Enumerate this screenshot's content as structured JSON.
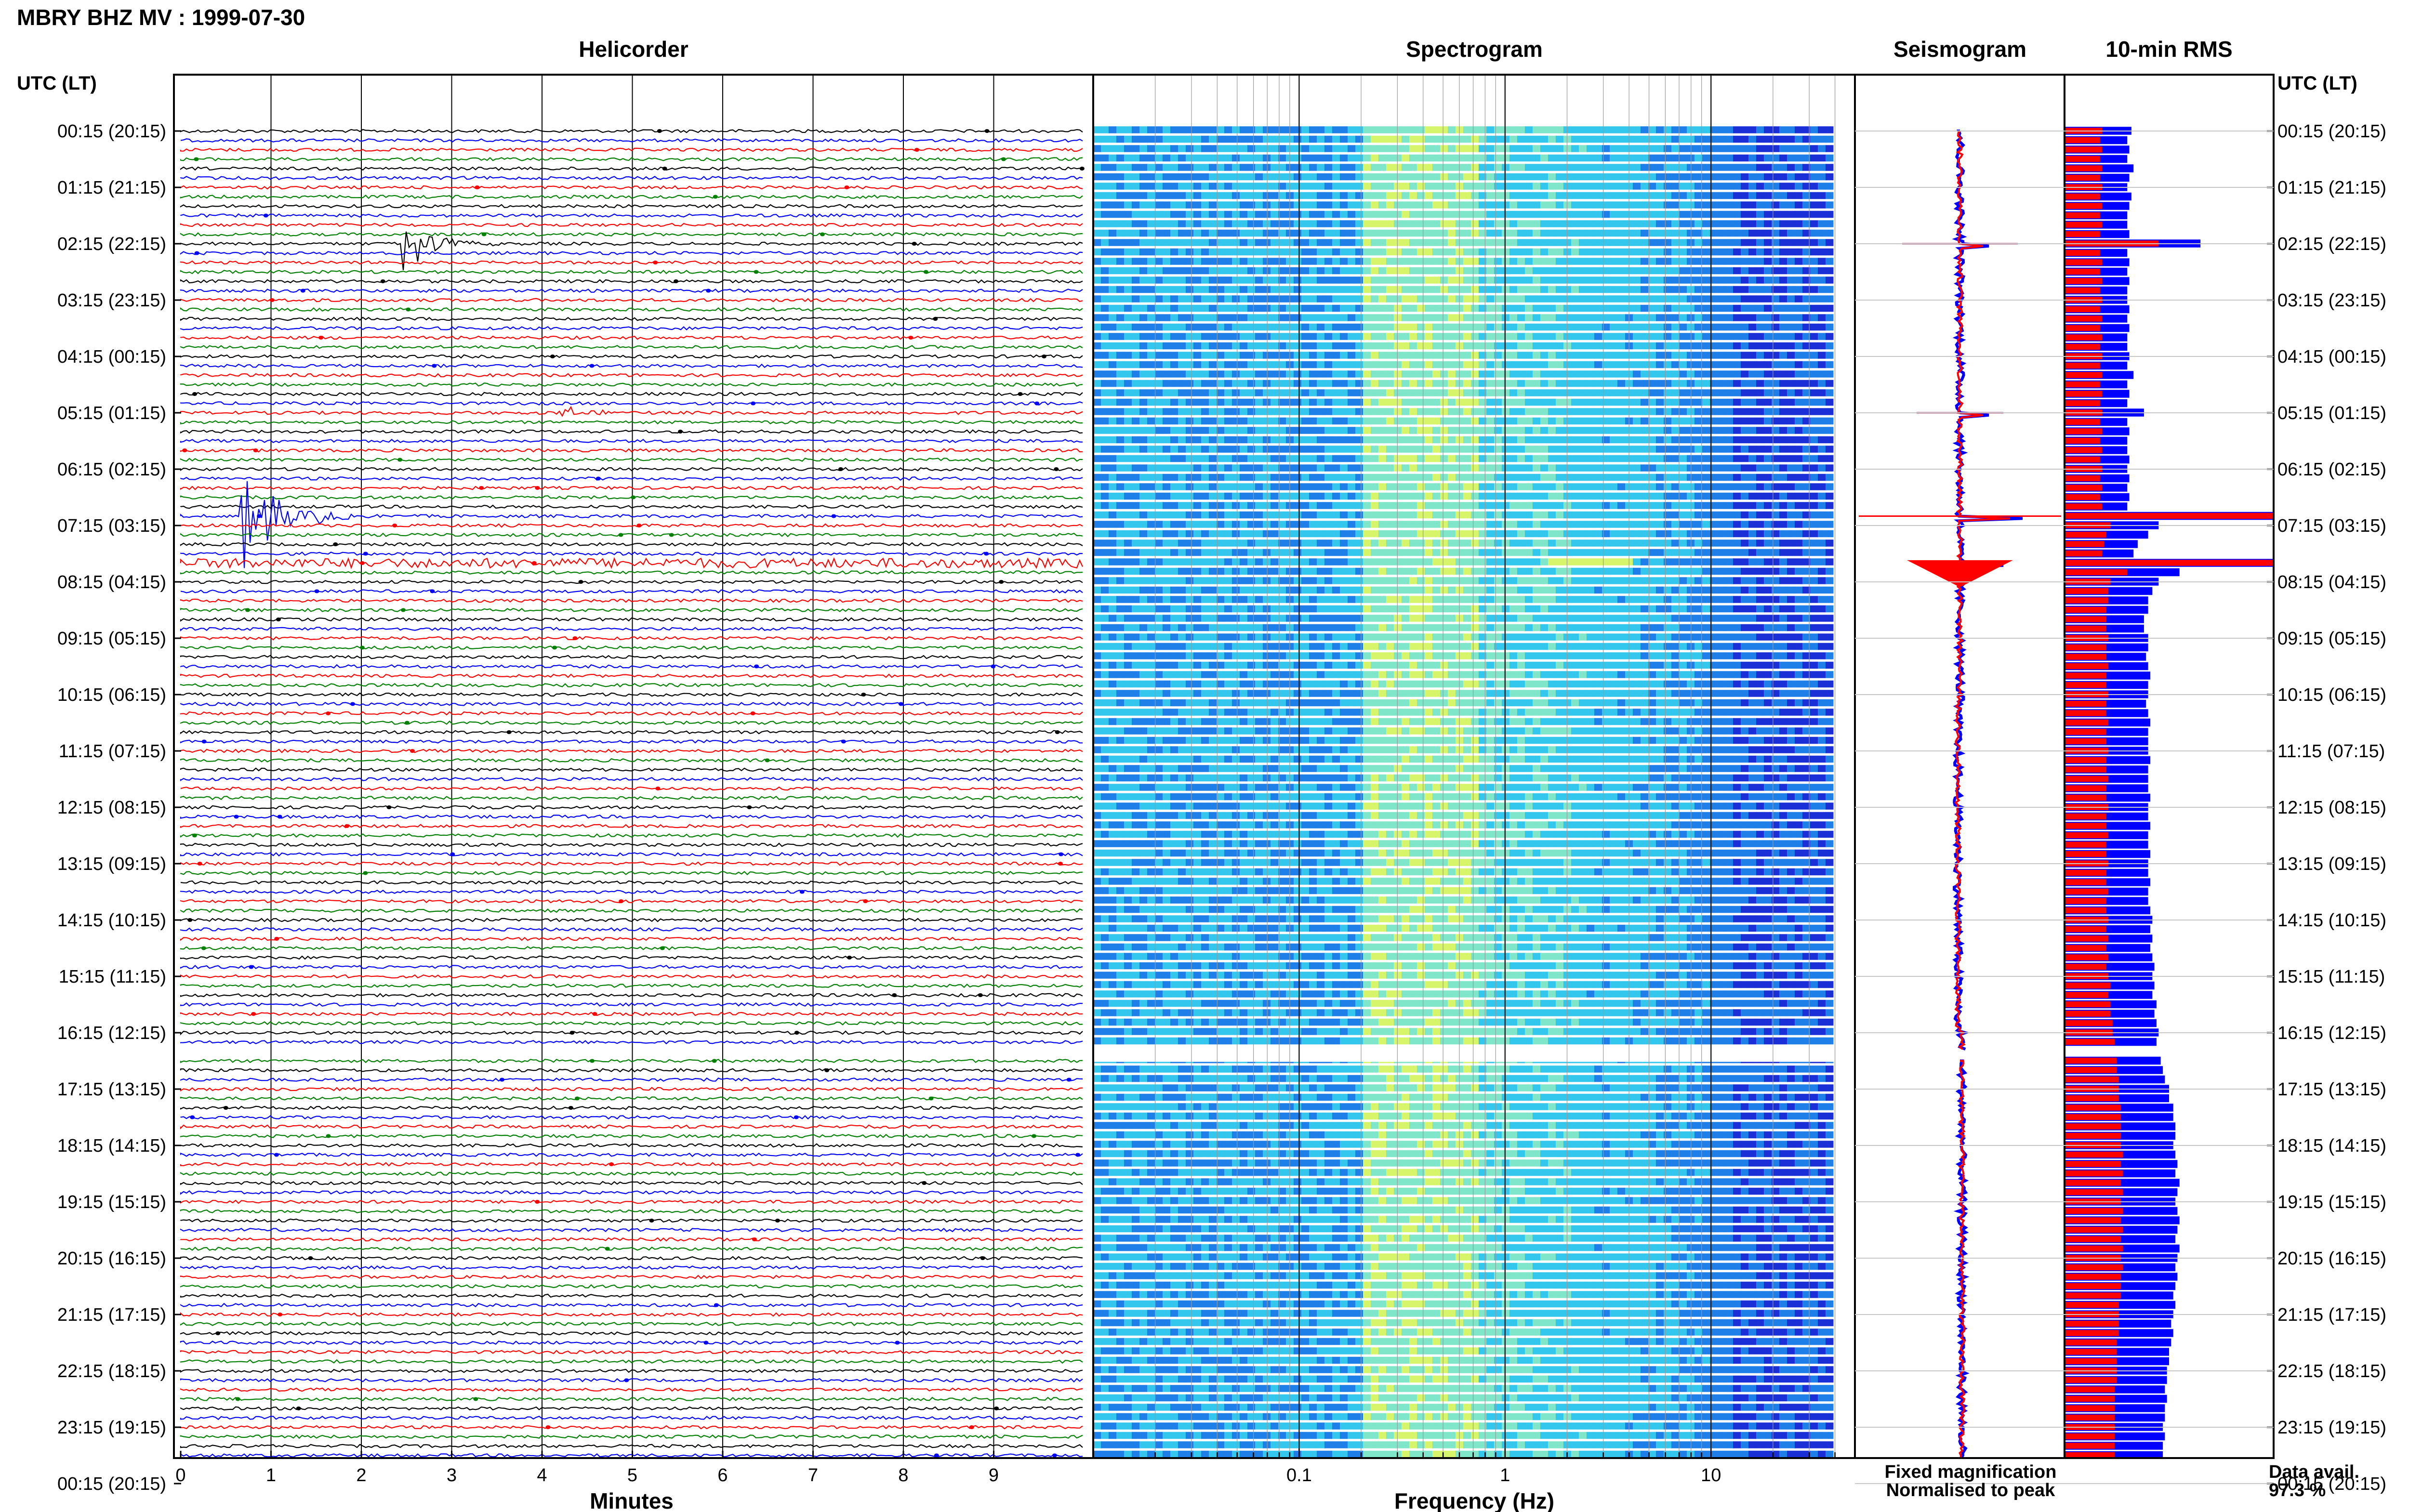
{
  "page_title": "MBRY BHZ MV : 1999-07-30",
  "panels": {
    "helicorder": "Helicorder",
    "spectrogram": "Spectrogram",
    "seismogram": "Seismogram",
    "rms": "10-min RMS"
  },
  "time_axis_label": "UTC (LT)",
  "time_labels": [
    "00:15 (20:15)",
    "01:15 (21:15)",
    "02:15 (22:15)",
    "03:15 (23:15)",
    "04:15 (00:15)",
    "05:15 (01:15)",
    "06:15 (02:15)",
    "07:15 (03:15)",
    "08:15 (04:15)",
    "09:15 (05:15)",
    "10:15 (06:15)",
    "11:15 (07:15)",
    "12:15 (08:15)",
    "13:15 (09:15)",
    "14:15 (10:15)",
    "15:15 (11:15)",
    "16:15 (12:15)",
    "17:15 (13:15)",
    "18:15 (14:15)",
    "19:15 (15:15)",
    "20:15 (16:15)",
    "21:15 (17:15)",
    "22:15 (18:15)",
    "23:15 (19:15)",
    "00:15 (20:15)"
  ],
  "legend": {
    "fixed": "Fixed magnification",
    "normalised": "Normalised to peak",
    "fixed_color": "#0000ff",
    "normalised_color": "#ff0000"
  },
  "data_availability": {
    "label": "Data avail.",
    "value": "97.3 %"
  },
  "chart_data": [
    {
      "type": "line",
      "title": "Helicorder",
      "xlabel": "Minutes",
      "ylabel": "UTC (LT)",
      "xlim": [
        0,
        10
      ],
      "x_ticks": [
        "0",
        "1",
        "2",
        "3",
        "4",
        "5",
        "6",
        "7",
        "8",
        "9"
      ],
      "trace_colors": [
        "#000000",
        "#0000ff",
        "#ff0000",
        "#008000"
      ],
      "rows": 144,
      "gap_rows": [
        98
      ],
      "events": [
        {
          "row": 12,
          "minute": 2.5,
          "amplitude": 1.4,
          "color": "#000000"
        },
        {
          "row": 30,
          "minute": 4.25,
          "amplitude": 0.35,
          "color": "#000000"
        },
        {
          "row": 41,
          "minute": 0.7,
          "amplitude": 3.2,
          "color": "#008000"
        },
        {
          "row": 41,
          "minute": 1.55,
          "amplitude": 0.3,
          "color": "#008000"
        },
        {
          "row": 46,
          "minute": 0.0,
          "amplitude": 0.6,
          "color": "#0000ff",
          "type": "tremor"
        }
      ]
    },
    {
      "type": "heatmap",
      "title": "Spectrogram",
      "xlabel": "Frequency (Hz)",
      "x_scale": "log",
      "xlim": [
        0.01,
        50
      ],
      "x_ticks": [
        "0.1",
        "1",
        "10"
      ],
      "colormap": [
        "#1a2fd6",
        "#1f7fe8",
        "#33c7ee",
        "#7fe6c9",
        "#d7f56b"
      ],
      "peak_band_hz": [
        0.2,
        0.6
      ],
      "gap_rows": [
        98
      ]
    },
    {
      "type": "line",
      "title": "Seismogram",
      "series": [
        {
          "name": "Fixed magnification",
          "color": "#0000ff"
        },
        {
          "name": "Normalised to peak",
          "color": "#ff0000"
        }
      ],
      "spikes_at_rows": [
        12,
        30,
        41,
        46
      ]
    },
    {
      "type": "bar",
      "title": "10-min RMS",
      "orientation": "horizontal",
      "series": [
        {
          "name": "Fixed magnification",
          "color": "#0000ff",
          "values": [
            0.32,
            0.3,
            0.31,
            0.3,
            0.33,
            0.31,
            0.3,
            0.32,
            0.31,
            0.3,
            0.3,
            0.31,
            0.65,
            0.3,
            0.31,
            0.3,
            0.31,
            0.3,
            0.3,
            0.31,
            0.3,
            0.31,
            0.3,
            0.3,
            0.31,
            0.3,
            0.33,
            0.3,
            0.31,
            0.3,
            0.38,
            0.3,
            0.31,
            0.3,
            0.3,
            0.31,
            0.3,
            0.31,
            0.3,
            0.31,
            0.3,
            1.0,
            0.45,
            0.4,
            0.35,
            0.33,
            1.0,
            0.55,
            0.45,
            0.42,
            0.4,
            0.4,
            0.38,
            0.38,
            0.4,
            0.4,
            0.39,
            0.4,
            0.41,
            0.4,
            0.4,
            0.39,
            0.4,
            0.41,
            0.4,
            0.4,
            0.4,
            0.41,
            0.4,
            0.4,
            0.4,
            0.41,
            0.4,
            0.4,
            0.41,
            0.4,
            0.4,
            0.41,
            0.4,
            0.4,
            0.41,
            0.4,
            0.4,
            0.41,
            0.42,
            0.41,
            0.42,
            0.41,
            0.42,
            0.43,
            0.42,
            0.43,
            0.42,
            0.44,
            0.43,
            0.44,
            0.45,
            0.44,
            0.45,
            0.46,
            0.47,
            0.48,
            0.5,
            0.5,
            0.52,
            0.52,
            0.53,
            0.53,
            0.52,
            0.53,
            0.54,
            0.53,
            0.55,
            0.54,
            0.53,
            0.54,
            0.55,
            0.54,
            0.53,
            0.55,
            0.54,
            0.53,
            0.54,
            0.53,
            0.52,
            0.53,
            0.52,
            0.51,
            0.52,
            0.51,
            0.5,
            0.5,
            0.49,
            0.49,
            0.48,
            0.49,
            0.48,
            0.48,
            0.47,
            0.48,
            0.47,
            0.47,
            0.47,
            0.4
          ]
        },
        {
          "name": "Normalised to peak",
          "color": "#ff0000",
          "values": [
            0.18,
            0.17,
            0.18,
            0.17,
            0.18,
            0.17,
            0.18,
            0.17,
            0.18,
            0.17,
            0.18,
            0.17,
            0.45,
            0.17,
            0.18,
            0.17,
            0.18,
            0.17,
            0.18,
            0.17,
            0.18,
            0.17,
            0.18,
            0.17,
            0.18,
            0.17,
            0.18,
            0.17,
            0.18,
            0.17,
            0.18,
            0.17,
            0.18,
            0.17,
            0.18,
            0.17,
            0.18,
            0.17,
            0.18,
            0.17,
            0.18,
            1.0,
            0.22,
            0.2,
            0.19,
            0.18,
            1.0,
            0.3,
            0.22,
            0.21,
            0.21,
            0.2,
            0.2,
            0.2,
            0.21,
            0.2,
            0.2,
            0.21,
            0.2,
            0.2,
            0.21,
            0.2,
            0.2,
            0.21,
            0.2,
            0.2,
            0.21,
            0.2,
            0.2,
            0.21,
            0.2,
            0.2,
            0.21,
            0.2,
            0.2,
            0.21,
            0.2,
            0.2,
            0.21,
            0.2,
            0.2,
            0.21,
            0.2,
            0.2,
            0.21,
            0.2,
            0.21,
            0.2,
            0.21,
            0.2,
            0.21,
            0.22,
            0.21,
            0.22,
            0.22,
            0.23,
            0.23,
            0.24,
            0.24,
            0.25,
            0.25,
            0.26,
            0.26,
            0.26,
            0.27,
            0.27,
            0.27,
            0.27,
            0.27,
            0.28,
            0.27,
            0.28,
            0.27,
            0.28,
            0.27,
            0.28,
            0.27,
            0.28,
            0.27,
            0.28,
            0.27,
            0.28,
            0.27,
            0.27,
            0.27,
            0.26,
            0.26,
            0.26,
            0.26,
            0.25,
            0.25,
            0.25,
            0.25,
            0.25,
            0.24,
            0.24,
            0.24,
            0.24,
            0.24,
            0.24,
            0.24,
            0.24,
            0.24,
            0.22
          ]
        }
      ],
      "gap_rows": [
        98
      ]
    }
  ]
}
